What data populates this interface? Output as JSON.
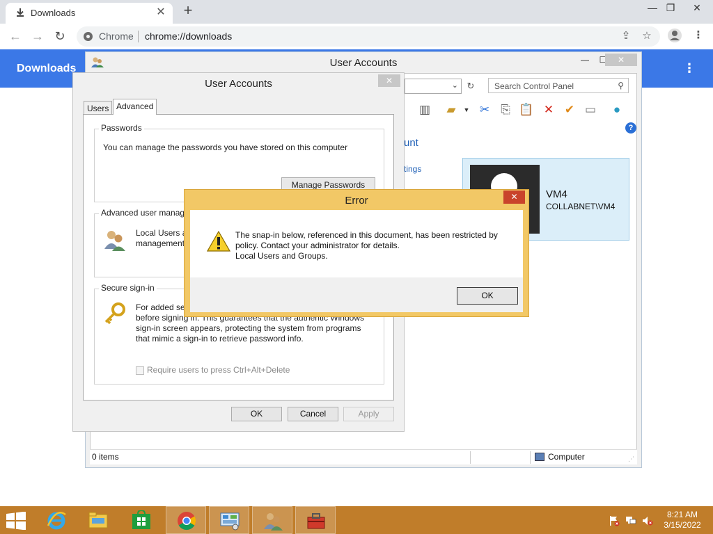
{
  "browser": {
    "tab_title": "Downloads",
    "omnibox_site": "Chrome",
    "omnibox_url": "chrome://downloads",
    "page_title": "Downloads"
  },
  "control_panel": {
    "title": "User Accounts",
    "search_placeholder": "Search Control Panel",
    "link_fragment_1": "unt",
    "link_fragment_2": "tings",
    "user_name": "VM4",
    "user_domain": "COLLABNET\\VM4",
    "status_items": "0 items",
    "status_location": "Computer"
  },
  "ua_dialog": {
    "title": "User Accounts",
    "tabs": [
      "Users",
      "Advanced"
    ],
    "passwords": {
      "title": "Passwords",
      "text": "You can manage the passwords you have stored on this computer",
      "button": "Manage Passwords"
    },
    "advanced_mgmt": {
      "title": "Advanced user manage",
      "text_line1": "Local Users ar",
      "text_line2": "management"
    },
    "secure_signin": {
      "title": "Secure sign-in",
      "text_line1": "For added sec",
      "text_line2": "before signing in. This guarantees that the authentic Windows",
      "text_line3": "sign-in screen appears, protecting the system from programs",
      "text_line4": "that mimic a sign-in to retrieve password info.",
      "checkbox_label": "Require users to press Ctrl+Alt+Delete"
    },
    "buttons": {
      "ok": "OK",
      "cancel": "Cancel",
      "apply": "Apply"
    }
  },
  "error_dialog": {
    "title": "Error",
    "message": "The snap-in below, referenced in this document, has been restricted by\npolicy. Contact your administrator for details.\nLocal Users and Groups.",
    "ok": "OK"
  },
  "taskbar": {
    "time": "8:21 AM",
    "date": "3/15/2022",
    "items": [
      "internet-explorer",
      "file-explorer",
      "store",
      "chrome",
      "control-panel",
      "user-accounts",
      "toolbox"
    ]
  },
  "colors": {
    "chrome_blue": "#3b78e7",
    "taskbar": "#c07d2a",
    "error_frame": "#f2c866",
    "close_red": "#c9432b"
  }
}
